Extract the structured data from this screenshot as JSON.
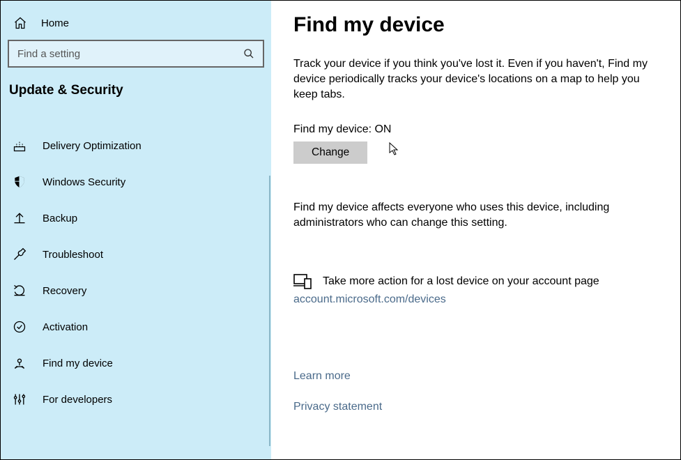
{
  "sidebar": {
    "home": "Home",
    "search_placeholder": "Find a setting",
    "category": "Update & Security",
    "items": [
      {
        "label": "Delivery Optimization"
      },
      {
        "label": "Windows Security"
      },
      {
        "label": "Backup"
      },
      {
        "label": "Troubleshoot"
      },
      {
        "label": "Recovery"
      },
      {
        "label": "Activation"
      },
      {
        "label": "Find my device"
      },
      {
        "label": "For developers"
      }
    ]
  },
  "main": {
    "title": "Find my device",
    "description": "Track your device if you think you've lost it. Even if you haven't, Find my device periodically tracks your device's locations on a map to help you keep tabs.",
    "status_label": "Find my device: ON",
    "change_button": "Change",
    "affects": "Find my device affects everyone who uses this device, including administrators who can change this setting.",
    "account_action": "Take more action for a lost device on your account page",
    "account_link": "account.microsoft.com/devices",
    "learn_more": "Learn more",
    "privacy": "Privacy statement"
  }
}
